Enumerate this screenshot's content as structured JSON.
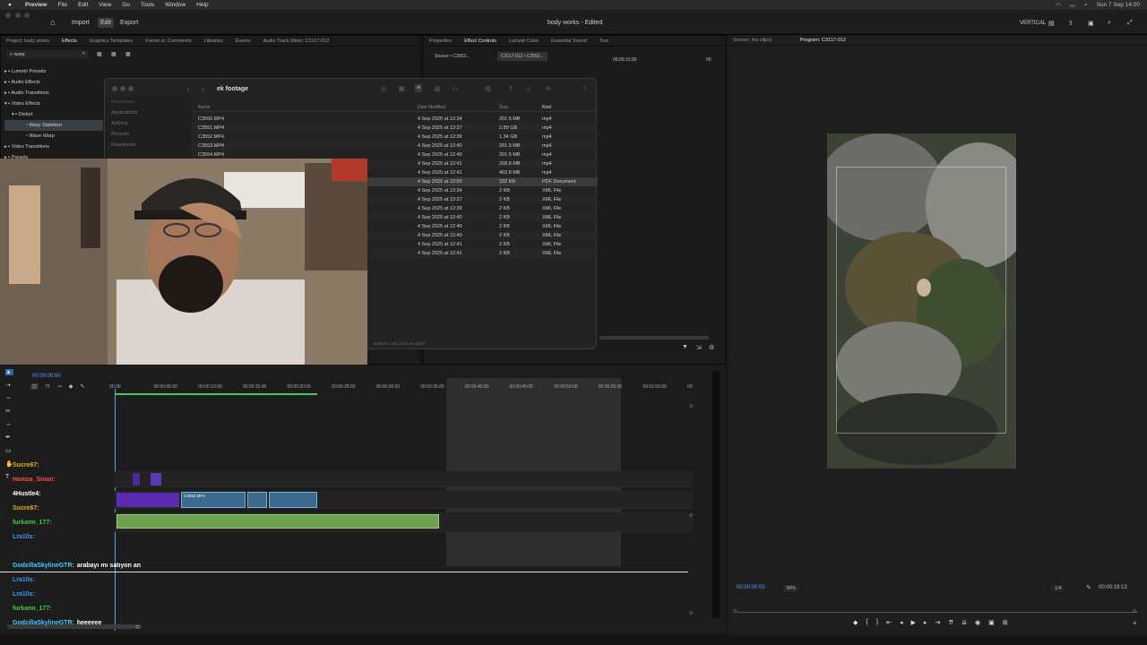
{
  "menubar": {
    "app": "Preview",
    "items": [
      "File",
      "Edit",
      "View",
      "Go",
      "Tools",
      "Window",
      "Help"
    ],
    "clock": "Sun 7 Sep 14:00"
  },
  "titlebar": {
    "home": "⌂",
    "import": "Import",
    "edit": "Edit",
    "export": "Export",
    "doc_title": "body works - Edited",
    "workspace": "VERTICAL"
  },
  "effects_panel": {
    "tabs": [
      "Project: body works",
      "Effects",
      "Graphics Templates",
      "Frame.io: Comments",
      "Libraries",
      "Events",
      "Audio Track Mixer: C3117-012"
    ],
    "active_tab": "Effects",
    "search_value": "warp",
    "tree": [
      "Lumetri Presets",
      "Audio Effects",
      "Audio Transitions",
      "Video Effects",
      "Distort",
      "Warp Stabilizer",
      "Wave Warp",
      "Video Transitions",
      "Presets"
    ]
  },
  "effect_controls": {
    "tabs": [
      "Properties",
      "Effect Controls",
      "Lumetri Color",
      "Essential Sound",
      "Text"
    ],
    "active_tab": "Effect Controls",
    "source": "Source • C3552...",
    "clip": "C3117-012 • C3552...",
    "time": "00;00;10;00",
    "time_end": "00"
  },
  "finder": {
    "title": "ek footage",
    "sidebar": [
      "Favourites",
      "Applications",
      "AirDrop",
      "Recents",
      "Downloads"
    ],
    "columns": {
      "name": "Name",
      "date": "Date Modified",
      "size": "Size",
      "kind": "Kind"
    },
    "rows": [
      {
        "name": "C3550.MP4",
        "date": "4 Sep 2025 at 12:34",
        "size": "201.5 MB",
        "kind": "mp4"
      },
      {
        "name": "C3551.MP4",
        "date": "4 Sep 2025 at 12:37",
        "size": "2.89 GB",
        "kind": "mp4"
      },
      {
        "name": "C3552.MP4",
        "date": "4 Sep 2025 at 12:39",
        "size": "1.34 GB",
        "kind": "mp4"
      },
      {
        "name": "C3553.MP4",
        "date": "4 Sep 2025 at 12:40",
        "size": "201.5 MB",
        "kind": "mp4"
      },
      {
        "name": "C3554.MP4",
        "date": "4 Sep 2025 at 12:40",
        "size": "201.5 MB",
        "kind": "mp4"
      },
      {
        "name": "",
        "date": "4 Sep 2025 at 12:41",
        "size": "268.8 MB",
        "kind": "mp4"
      },
      {
        "name": "",
        "date": "4 Sep 2025 at 12:41",
        "size": "402.8 MB",
        "kind": "mp4"
      },
      {
        "name": "",
        "date": "4 Sep 2025 at 12:50",
        "size": "332 KB",
        "kind": "PDF Document"
      },
      {
        "name": "",
        "date": "4 Sep 2025 at 12:34",
        "size": "2 KB",
        "kind": "XML File"
      },
      {
        "name": "",
        "date": "4 Sep 2025 at 12:37",
        "size": "2 KB",
        "kind": "XML File"
      },
      {
        "name": "",
        "date": "4 Sep 2025 at 12:39",
        "size": "2 KB",
        "kind": "XML File"
      },
      {
        "name": "",
        "date": "4 Sep 2025 at 12:40",
        "size": "2 KB",
        "kind": "XML File"
      },
      {
        "name": "",
        "date": "4 Sep 2025 at 12:40",
        "size": "2 KB",
        "kind": "XML File"
      },
      {
        "name": "",
        "date": "4 Sep 2025 at 12:40",
        "size": "2 KB",
        "kind": "XML File"
      },
      {
        "name": "",
        "date": "4 Sep 2025 at 12:41",
        "size": "2 KB",
        "kind": "XML File"
      },
      {
        "name": "",
        "date": "4 Sep 2025 at 12:41",
        "size": "2 KB",
        "kind": "XML File"
      }
    ],
    "status": "selected, 186.3 GB available"
  },
  "program_monitor": {
    "source_tab": "Source: (no clips)",
    "program_tab": "Program: C3117-012",
    "timecode": "00:00:00:00",
    "zoom": "39%",
    "quality": "1/4",
    "duration": "00:00:19:13"
  },
  "timeline": {
    "current_time": "00:00:00:00",
    "ruler_ticks": [
      "00:00",
      "00:00:05:00",
      "00:00:10:00",
      "00:00:15:00",
      "00:00:20:00",
      "00:00:25:00",
      "00:00:30:00",
      "00:00:35:00",
      "00:00:40:00",
      "00:00:45:00",
      "00:00:50:00",
      "00:00:55:00",
      "00:01:00:00",
      "00:"
    ],
    "clip_label": "C3552.MP4"
  },
  "chat": [
    {
      "user": "Sucre67:",
      "msg": "",
      "color": "#e0b020"
    },
    {
      "user": "Hamza_Sinan:",
      "msg": "",
      "color": "#ff4a4a"
    },
    {
      "user": "4Hustle4:",
      "msg": "",
      "color": "#ffffff"
    },
    {
      "user": "Sucre67:",
      "msg": "",
      "color": "#e0b020"
    },
    {
      "user": "furkann_177:",
      "msg": "",
      "color": "#40d040"
    },
    {
      "user": "Lra10s:",
      "msg": "",
      "color": "#3a9af0"
    },
    {
      "user": "",
      "msg": "",
      "color": "#ff3030"
    },
    {
      "user": "GodzillaSkylineGTR:",
      "msg": "arabayı mı satıyon an",
      "color": "#40d0ff"
    },
    {
      "user": "Lra10s:",
      "msg": "",
      "color": "#3a9af0"
    },
    {
      "user": "Lra10s:",
      "msg": "",
      "color": "#3a9af0"
    },
    {
      "user": "furkann_177:",
      "msg": "",
      "color": "#40d040"
    },
    {
      "user": "GodzillaSkylineGTR:",
      "msg": "heeeeee",
      "color": "#40d0ff"
    }
  ]
}
